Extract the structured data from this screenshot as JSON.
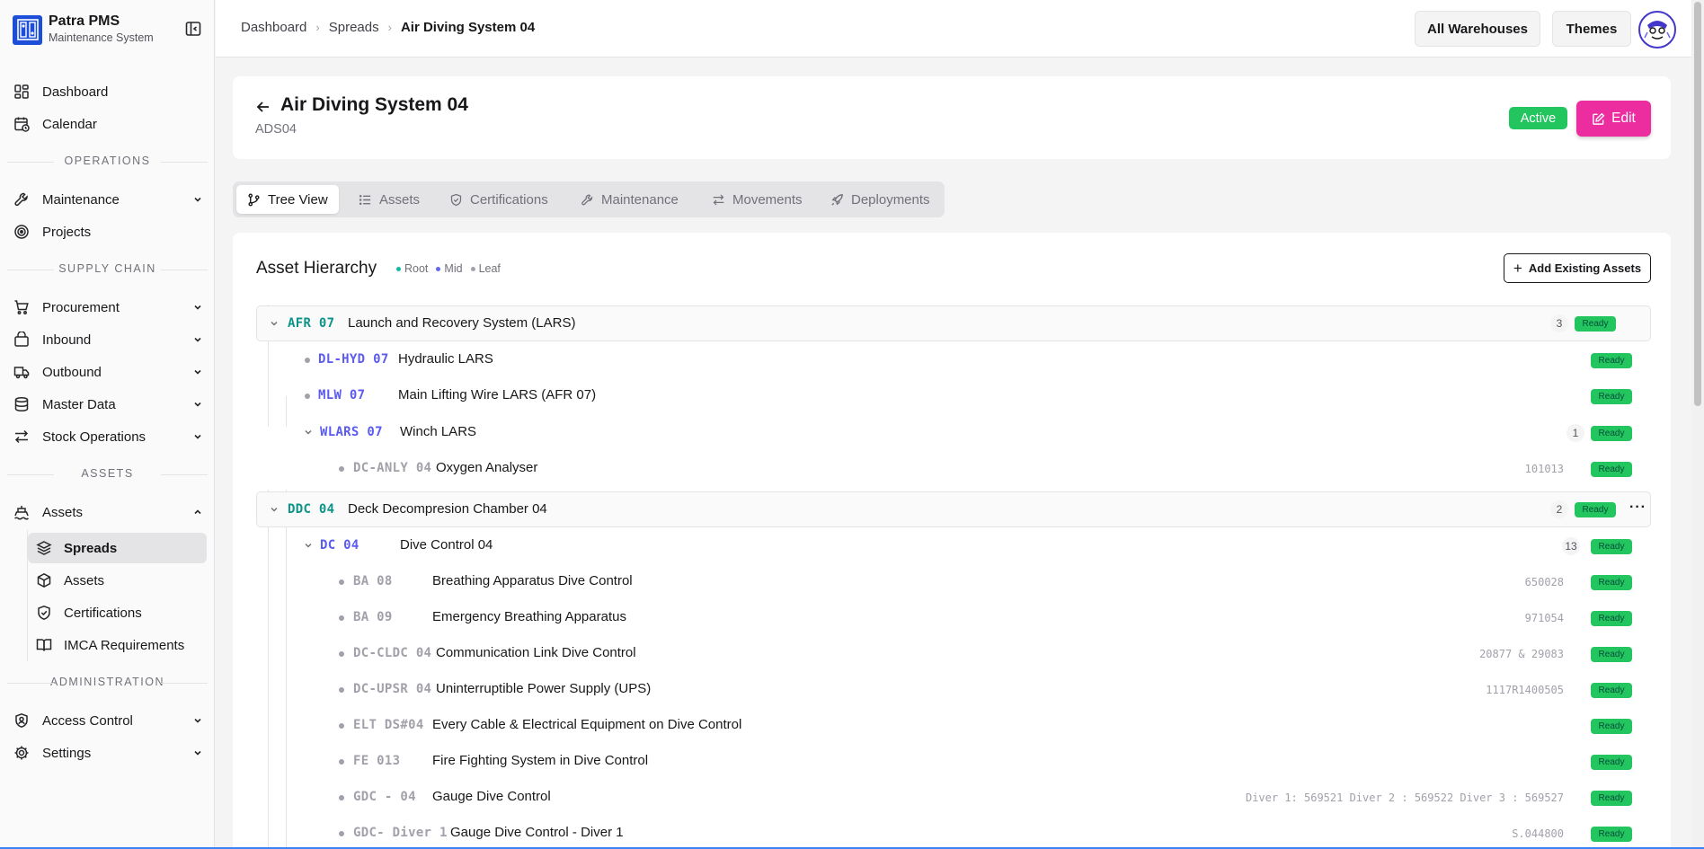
{
  "brand": {
    "name": "Patra PMS",
    "subtitle": "Maintenance System"
  },
  "sidebar": {
    "top_items": [
      {
        "label": "Dashboard",
        "icon": "dashboard-icon"
      },
      {
        "label": "Calendar",
        "icon": "calendar-icon"
      }
    ],
    "sections": {
      "operations": "OPERATIONS",
      "supply_chain": "SUPPLY CHAIN",
      "assets": "ASSETS",
      "administration": "ADMINISTRATION"
    },
    "operations_items": [
      {
        "label": "Maintenance",
        "icon": "wrench-icon",
        "expandable": true
      },
      {
        "label": "Projects",
        "icon": "target-icon",
        "expandable": false
      }
    ],
    "supply_items": [
      {
        "label": "Procurement",
        "icon": "cart-icon"
      },
      {
        "label": "Inbound",
        "icon": "package-icon"
      },
      {
        "label": "Outbound",
        "icon": "truck-icon"
      },
      {
        "label": "Master Data",
        "icon": "database-icon"
      },
      {
        "label": "Stock Operations",
        "icon": "transfer-icon"
      }
    ],
    "assets_item": {
      "label": "Assets",
      "icon": "ship-icon",
      "expanded": true
    },
    "assets_sub": [
      {
        "label": "Spreads",
        "icon": "layers-icon",
        "active": true
      },
      {
        "label": "Assets",
        "icon": "box-icon",
        "active": false
      },
      {
        "label": "Certifications",
        "icon": "shield-check-icon",
        "active": false
      },
      {
        "label": "IMCA Requirements",
        "icon": "book-icon",
        "active": false
      }
    ],
    "admin_items": [
      {
        "label": "Access Control",
        "icon": "shield-user-icon"
      },
      {
        "label": "Settings",
        "icon": "gear-icon"
      }
    ]
  },
  "topbar": {
    "breadcrumb": [
      "Dashboard",
      "Spreads",
      "Air Diving System 04"
    ],
    "warehouses_label": "All Warehouses",
    "themes_label": "Themes"
  },
  "header": {
    "title": "Air Diving System 04",
    "code": "ADS04",
    "status": "Active",
    "edit_label": "Edit"
  },
  "tabs": [
    {
      "label": "Tree View",
      "icon": "branch-icon",
      "active": true
    },
    {
      "label": "Assets",
      "icon": "list-icon",
      "active": false
    },
    {
      "label": "Certifications",
      "icon": "shield-check-icon",
      "active": false
    },
    {
      "label": "Maintenance",
      "icon": "wrench-icon",
      "active": false
    },
    {
      "label": "Movements",
      "icon": "transfer-icon",
      "active": false
    },
    {
      "label": "Deployments",
      "icon": "rocket-icon",
      "active": false
    }
  ],
  "hierarchy": {
    "title": "Asset Hierarchy",
    "legend": [
      {
        "label": "Root",
        "color": "#14b8a6"
      },
      {
        "label": "Mid",
        "color": "#6366f1"
      },
      {
        "label": "Leaf",
        "color": "#a1a1aa"
      }
    ],
    "add_label": "Add Existing Assets",
    "ready_label": "Ready",
    "rows": [
      {
        "code": "AFR 07",
        "name": "Launch and Recovery System (LARS)",
        "level": "root",
        "count": "3",
        "serial": ""
      },
      {
        "code": "DL-HYD 07",
        "name": "Hydraulic LARS",
        "level": "mid-leaf",
        "count": "",
        "serial": ""
      },
      {
        "code": "MLW 07",
        "name": "Main Lifting Wire LARS (AFR 07)",
        "level": "mid-leaf",
        "count": "",
        "serial": ""
      },
      {
        "code": "WLARS 07",
        "name": "Winch LARS",
        "level": "mid",
        "count": "1",
        "serial": ""
      },
      {
        "code": "DC-ANLY 04",
        "name": "Oxygen Analyser",
        "level": "leaf",
        "count": "",
        "serial": "101013"
      },
      {
        "code": "DDC 04",
        "name": "Deck Decompresion Chamber 04",
        "level": "root",
        "count": "2",
        "serial": ""
      },
      {
        "code": "DC 04",
        "name": "Dive Control 04",
        "level": "mid",
        "count": "13",
        "serial": ""
      },
      {
        "code": "BA 08",
        "name": "Breathing Apparatus Dive Control",
        "level": "leaf",
        "count": "",
        "serial": "650028"
      },
      {
        "code": "BA 09",
        "name": "Emergency Breathing Apparatus",
        "level": "leaf",
        "count": "",
        "serial": "971054"
      },
      {
        "code": "DC-CLDC 04",
        "name": "Communication Link Dive Control",
        "level": "leaf",
        "count": "",
        "serial": "20877 & 29083"
      },
      {
        "code": "DC-UPSR 04",
        "name": "Uninterruptible Power Supply (UPS)",
        "level": "leaf",
        "count": "",
        "serial": "1117R1400505"
      },
      {
        "code": "ELT DS#04",
        "name": "Every Cable & Electrical Equipment on Dive Control",
        "level": "leaf",
        "count": "",
        "serial": ""
      },
      {
        "code": "FE 013",
        "name": "Fire Fighting System in Dive Control",
        "level": "leaf",
        "count": "",
        "serial": ""
      },
      {
        "code": "GDC - 04",
        "name": "Gauge Dive Control",
        "level": "leaf",
        "count": "",
        "serial": "Diver 1: 569521 Diver 2 : 569522 Diver 3 : 569527"
      },
      {
        "code": "GDC- Diver 1",
        "name": "Gauge Dive Control - Diver 1",
        "level": "leaf",
        "count": "",
        "serial": "S.044800"
      }
    ]
  },
  "colors": {
    "accent": "#ec2da0",
    "success": "#22c55e",
    "root": "#0d9488",
    "mid": "#5b5bf0"
  }
}
